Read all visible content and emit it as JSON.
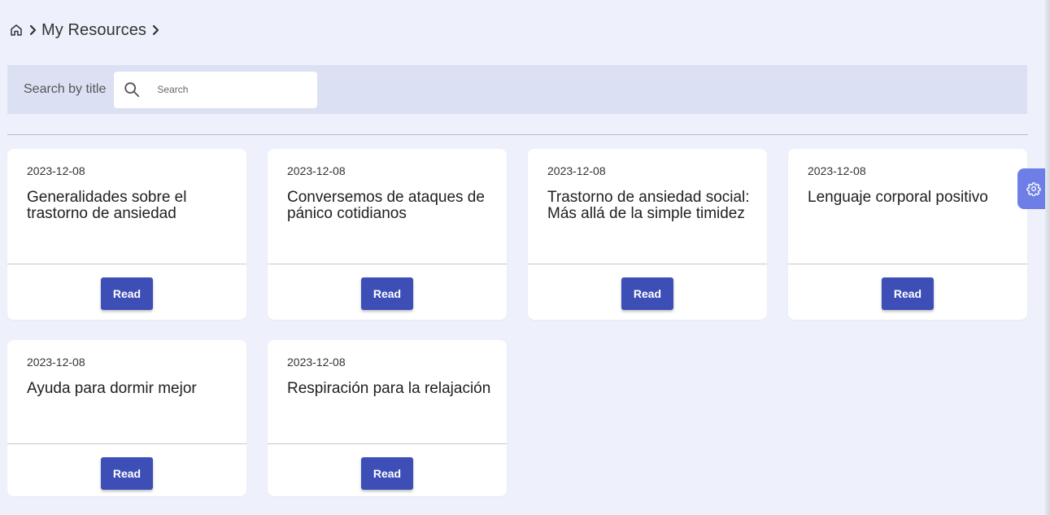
{
  "breadcrumb": {
    "home_icon": "home-icon",
    "items": [
      {
        "label": "My Resources"
      }
    ]
  },
  "search": {
    "label": "Search by title",
    "placeholder": "Search",
    "value": "",
    "icon": "search-icon"
  },
  "resources": [
    {
      "date": "2023-12-08",
      "title": "Generalidades sobre el trastorno de ansiedad",
      "button_label": "Read"
    },
    {
      "date": "2023-12-08",
      "title": "Conversemos de ataques de pánico cotidianos",
      "button_label": "Read"
    },
    {
      "date": "2023-12-08",
      "title": "Trastorno de ansiedad social: Más allá de la simple timidez",
      "button_label": "Read"
    },
    {
      "date": "2023-12-08",
      "title": "Lenguaje corporal positivo",
      "button_label": "Read"
    },
    {
      "date": "2023-12-08",
      "title": "Ayuda para dormir mejor",
      "button_label": "Read"
    },
    {
      "date": "2023-12-08",
      "title": "Respiración para la relajación",
      "button_label": "Read"
    }
  ],
  "settings_tab": {
    "icon": "gear-icon"
  },
  "colors": {
    "background": "#eef1fb",
    "search_bar": "#dbe0f3",
    "button": "#3d4fb6",
    "settings_tab": "#6d7fe6"
  }
}
